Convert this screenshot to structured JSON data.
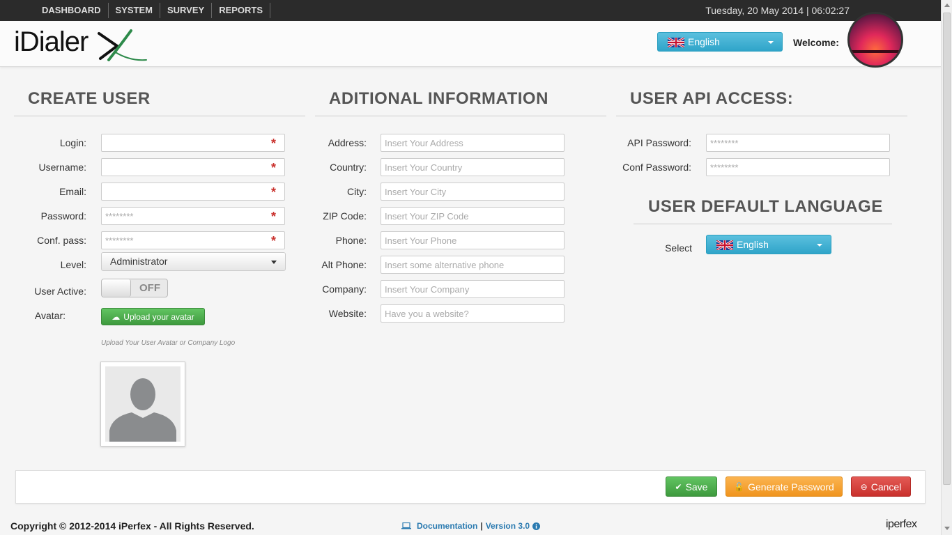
{
  "nav": {
    "items": [
      "DASHBOARD",
      "SYSTEM",
      "SURVEY",
      "REPORTS"
    ],
    "datetime": "Tuesday, 20 May 2014 | 06:02:27"
  },
  "header": {
    "logo_text": "iDialer",
    "language": "English",
    "welcome_label": "Welcome:"
  },
  "create_user": {
    "title": "CREATE USER",
    "login_label": "Login:",
    "username_label": "Username:",
    "email_label": "Email:",
    "password_label": "Password:",
    "password_placeholder": "********",
    "conf_pass_label": "Conf. pass:",
    "conf_pass_placeholder": "********",
    "level_label": "Level:",
    "level_value": "Administrator",
    "active_label": "User Active:",
    "active_state": "OFF",
    "avatar_label": "Avatar:",
    "upload_label": "Upload your avatar",
    "upload_hint": "Upload Your User Avatar or Company Logo",
    "required_mark": "*"
  },
  "additional": {
    "title": "ADITIONAL INFORMATION",
    "fields": [
      {
        "label": "Address:",
        "placeholder": "Insert Your Address"
      },
      {
        "label": "Country:",
        "placeholder": "Insert Your Country"
      },
      {
        "label": "City:",
        "placeholder": "Insert Your City"
      },
      {
        "label": "ZIP Code:",
        "placeholder": "Insert Your ZIP Code"
      },
      {
        "label": "Phone:",
        "placeholder": "Insert Your Phone"
      },
      {
        "label": "Alt Phone:",
        "placeholder": "Insert some alternative phone"
      },
      {
        "label": "Company:",
        "placeholder": "Insert Your Company"
      },
      {
        "label": "Website:",
        "placeholder": "Have you a website?"
      }
    ]
  },
  "api": {
    "title": "USER API ACCESS:",
    "api_password_label": "API Password:",
    "api_password_placeholder": "********",
    "conf_password_label": "Conf Password:",
    "conf_password_placeholder": "********"
  },
  "default_language": {
    "title": "USER DEFAULT LANGUAGE",
    "select_label": "Select",
    "value": "English"
  },
  "actions": {
    "save": "Save",
    "generate": "Generate Password",
    "cancel": "Cancel"
  },
  "footer": {
    "copyright": "Copyright © 2012-2014 iPerfex - All Rights Reserved.",
    "documentation": "Documentation",
    "separator": "|",
    "version": "Version 3.0",
    "brand": "iperfex"
  },
  "colors": {
    "info": "#2fa4c9",
    "success": "#3e9a3e",
    "warning": "#f0941e",
    "danger": "#c9302c"
  }
}
